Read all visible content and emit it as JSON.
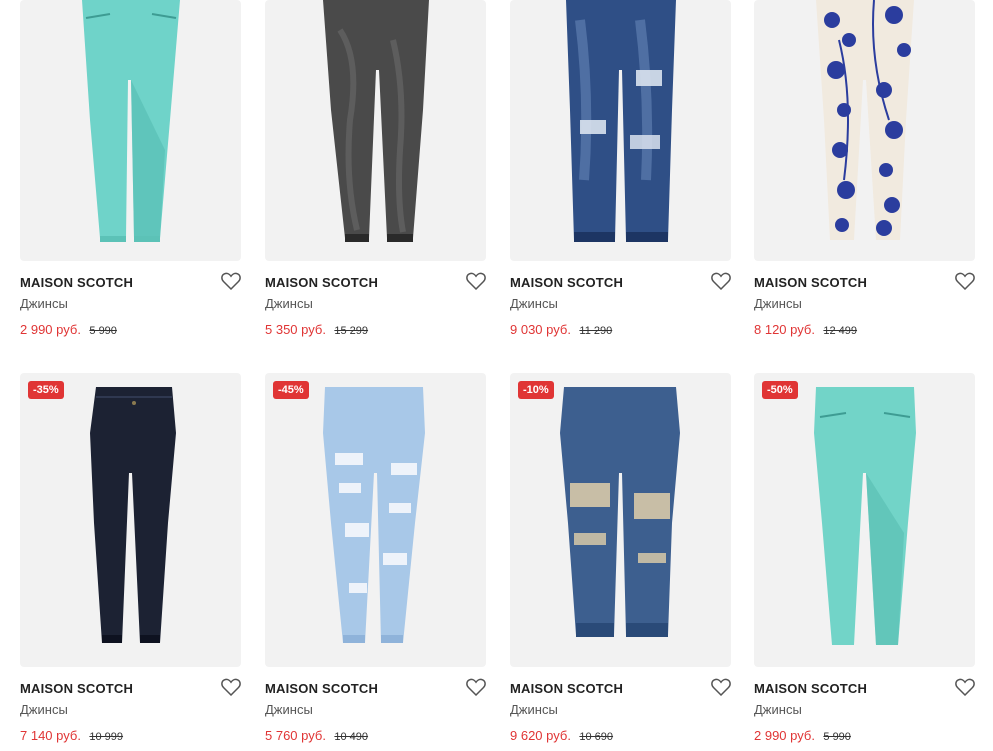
{
  "colors": {
    "accent": "#e03535",
    "card_bg": "#f2f2f2",
    "text": "#222222",
    "muted": "#555555"
  },
  "products": [
    {
      "brand": "MAISON SCOTCH",
      "category": "Джинсы",
      "price": "2 990 руб.",
      "old_price": "5 990",
      "badge": "",
      "color": "#6fd3c9",
      "shade": "#4fb8ae",
      "style": "mint-top"
    },
    {
      "brand": "MAISON SCOTCH",
      "category": "Джинсы",
      "price": "5 350 руб.",
      "old_price": "15 299",
      "badge": "",
      "color": "#4a4a4a",
      "shade": "#2a2a2a",
      "style": "black-wash"
    },
    {
      "brand": "MAISON SCOTCH",
      "category": "Джинсы",
      "price": "9 030 руб.",
      "old_price": "11 290",
      "badge": "",
      "color": "#2f4f86",
      "shade": "#1d3563",
      "style": "blue-ripped-top"
    },
    {
      "brand": "MAISON SCOTCH",
      "category": "Джинсы",
      "price": "8 120 руб.",
      "old_price": "12 499",
      "badge": "",
      "color": "#f1eadf",
      "shade": "#2b3d9e",
      "style": "floral"
    },
    {
      "brand": "MAISON SCOTCH",
      "category": "Джинсы",
      "price": "7 140 руб.",
      "old_price": "10 999",
      "badge": "-35%",
      "color": "#1c2233",
      "shade": "#0e1220",
      "style": "dark-skinny"
    },
    {
      "brand": "MAISON SCOTCH",
      "category": "Джинсы",
      "price": "5 760 руб.",
      "old_price": "10 490",
      "badge": "-45%",
      "color": "#a8c8e8",
      "shade": "#8fb3da",
      "style": "light-ripped"
    },
    {
      "brand": "MAISON SCOTCH",
      "category": "Джинсы",
      "price": "9 620 руб.",
      "old_price": "10 690",
      "badge": "-10%",
      "color": "#3d5f8f",
      "shade": "#2a4a78",
      "style": "boyfriend-ripped"
    },
    {
      "brand": "MAISON SCOTCH",
      "category": "Джинсы",
      "price": "2 990 руб.",
      "old_price": "5 990",
      "badge": "-50%",
      "color": "#72d4c8",
      "shade": "#52b8ac",
      "style": "mint-full"
    }
  ]
}
